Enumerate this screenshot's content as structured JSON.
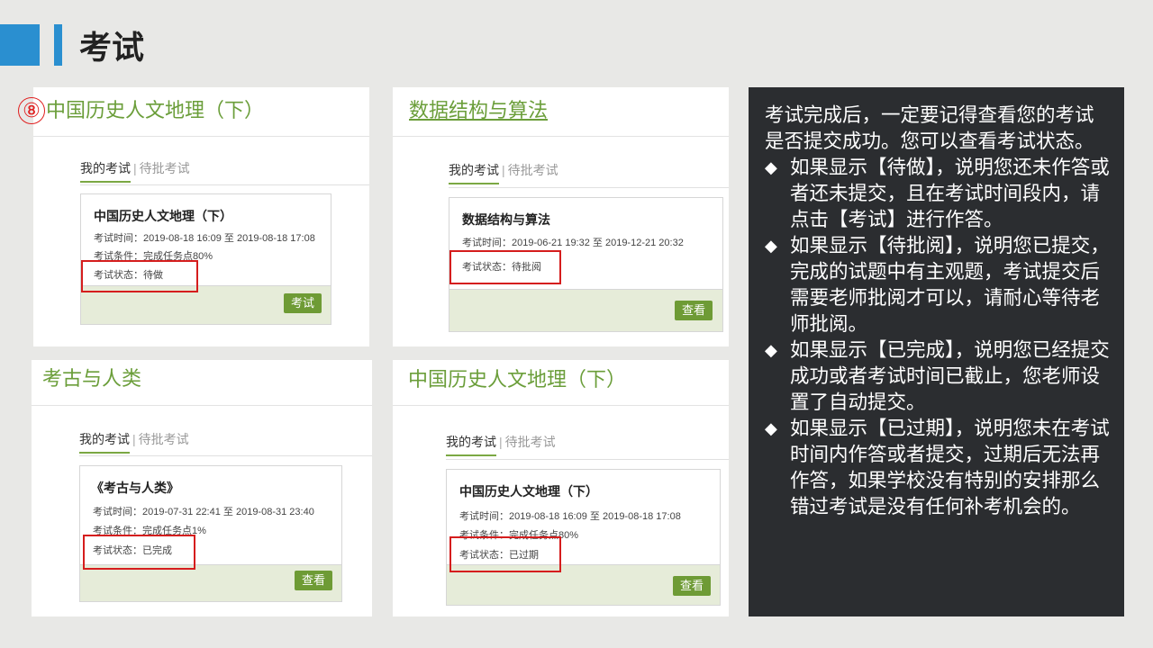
{
  "slide": {
    "title": "考试",
    "marker": "⑧"
  },
  "panels": [
    {
      "title": "中国历史人文地理（下）",
      "tabs": {
        "active": "我的考试",
        "separator": "|",
        "inactive": "待批考试"
      },
      "card": {
        "title": "中国历史人文地理（下）",
        "time": "考试时间：2019-08-18 16:09 至 2019-08-18 17:08",
        "condition": "考试条件：完成任务点80%",
        "status": "考试状态：待做",
        "button": "考试"
      }
    },
    {
      "title": "数据结构与算法",
      "tabs": {
        "active": "我的考试",
        "separator": "|",
        "inactive": "待批考试"
      },
      "card": {
        "title": "数据结构与算法",
        "time": "考试时间：2019-06-21 19:32 至 2019-12-21 20:32",
        "status": "考试状态：待批阅",
        "button": "查看"
      }
    },
    {
      "title": "考古与人类",
      "tabs": {
        "active": "我的考试",
        "separator": "|",
        "inactive": "待批考试"
      },
      "card": {
        "title": "《考古与人类》",
        "time": "考试时间：2019-07-31 22:41 至 2019-08-31 23:40",
        "condition": "考试条件：完成任务点1%",
        "status": "考试状态：已完成",
        "button": "查看"
      }
    },
    {
      "title": "中国历史人文地理（下）",
      "tabs": {
        "active": "我的考试",
        "separator": "|",
        "inactive": "待批考试"
      },
      "card": {
        "title": "中国历史人文地理（下）",
        "time": "考试时间：2019-08-18 16:09 至 2019-08-18 17:08",
        "condition": "考试条件：完成任务点80%",
        "status": "考试状态：已过期",
        "button": "查看"
      }
    }
  ],
  "notes": {
    "intro": "考试完成后，一定要记得查看您的考试是否提交成功。您可以查看考试状态。",
    "bullet_symbol": "◆",
    "bullets": [
      "如果显示【待做】，说明您还未作答或者还未提交，且在考试时间段内，请点击【考试】进行作答。",
      "如果显示【待批阅】，说明您已提交，完成的试题中有主观题，考试提交后需要老师批阅才可以，请耐心等待老师批阅。",
      "如果显示【已完成】，说明您已经提交成功或者考试时间已截止，您老师设置了自动提交。",
      "如果显示【已过期】，说明您未在考试时间内作答或者提交，过期后无法再作答，如果学校没有特别的安排那么错过考试是没有任何补考机会的。"
    ]
  }
}
